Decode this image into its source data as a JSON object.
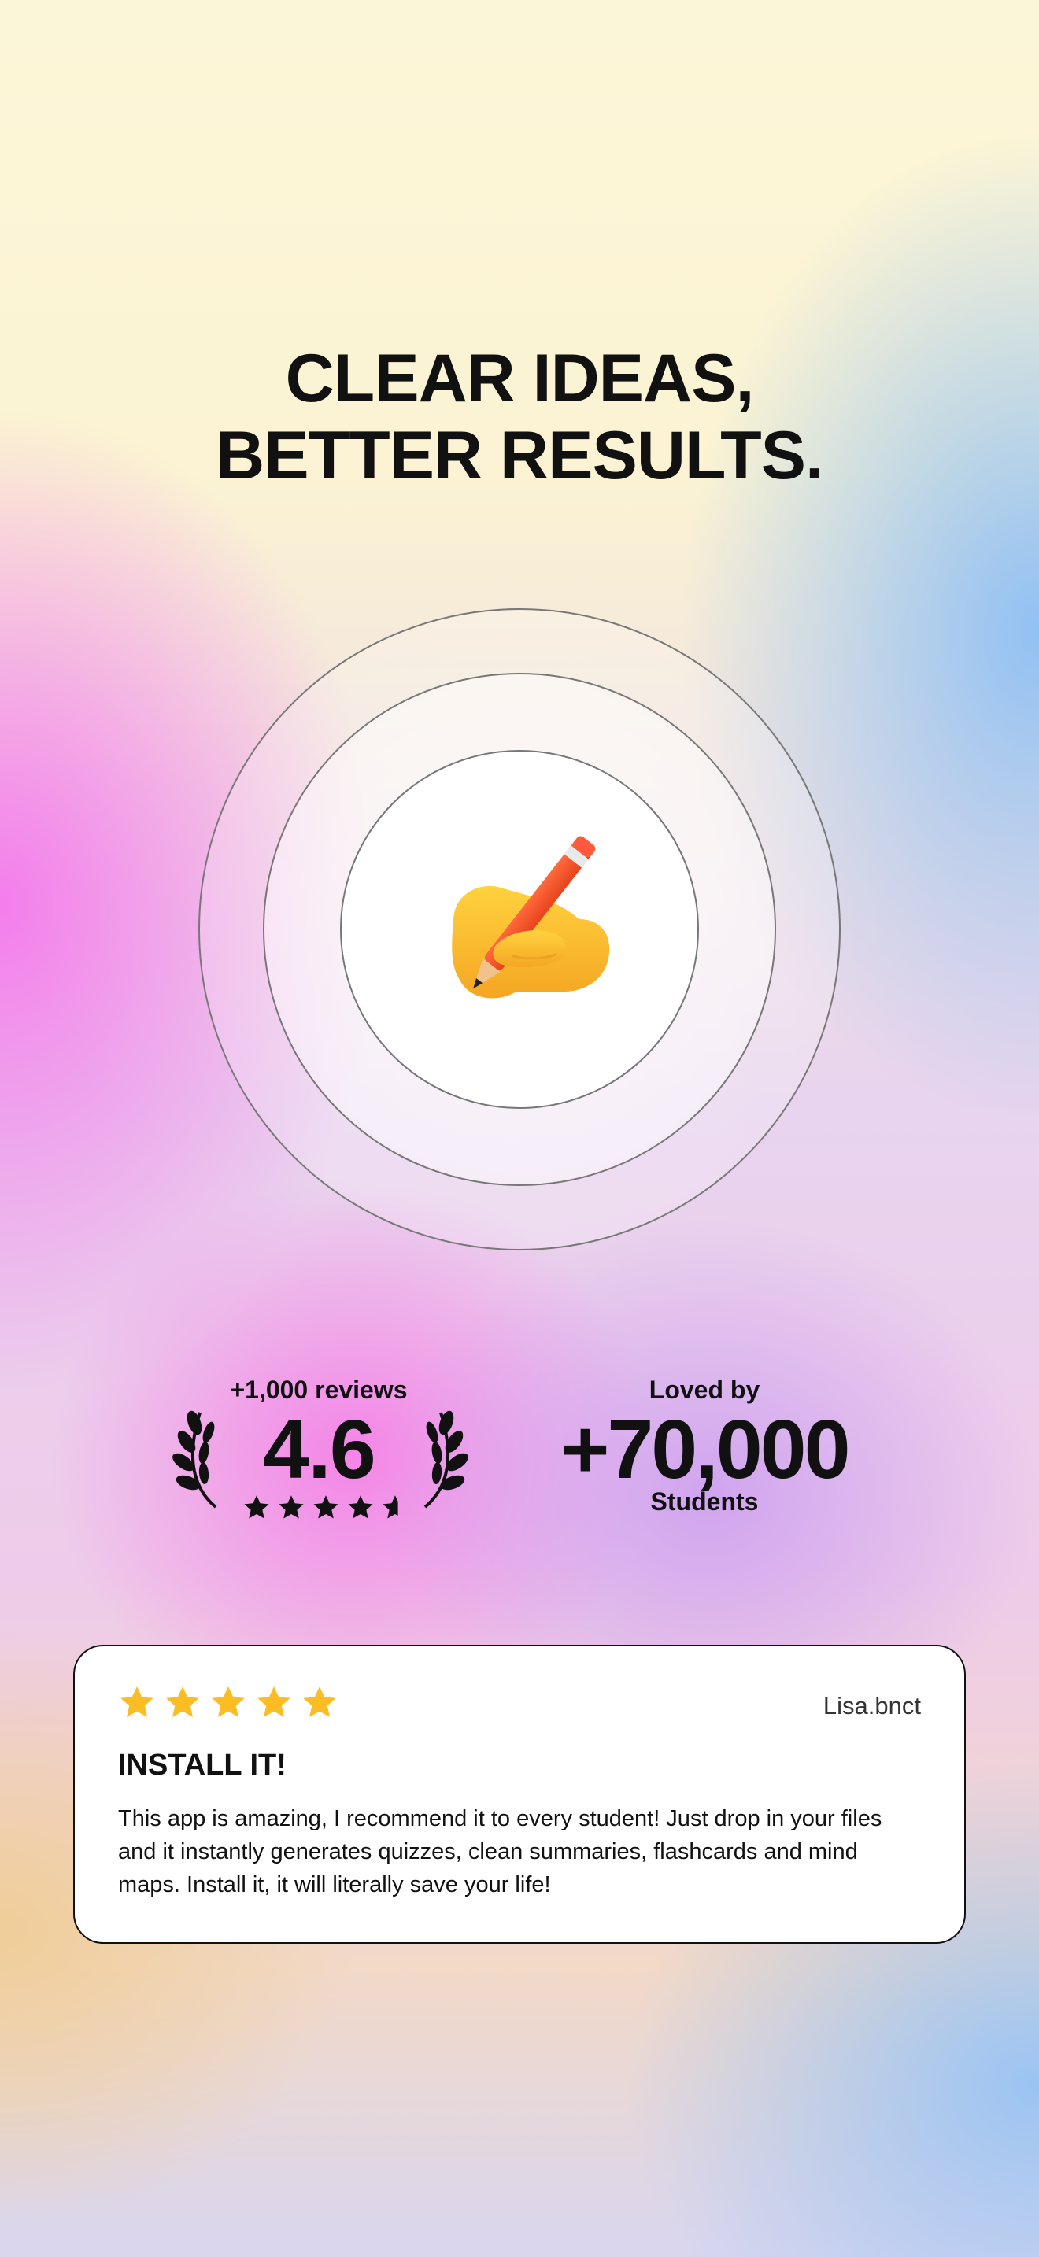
{
  "headline": {
    "line1": "CLEAR IDEAS,",
    "line2": "BETTER RESULTS."
  },
  "hero": {
    "icon": "writing-hand-icon"
  },
  "stats": {
    "reviews_label": "+1,000 reviews",
    "rating": "4.6",
    "rating_stars": 4.6,
    "loved_label": "Loved by",
    "students_value": "+70,000",
    "students_label": "Students"
  },
  "review": {
    "stars": 5,
    "reviewer": "Lisa.bnct",
    "title": "INSTALL IT!",
    "body": "This app is amazing, I recommend it to every student! Just drop in your files and it instantly generates quizzes, clean summaries, flashcards and mind maps. Install it, it will literally save your life!"
  },
  "colors": {
    "star_gold": "#fbbd23",
    "text": "#111111"
  }
}
